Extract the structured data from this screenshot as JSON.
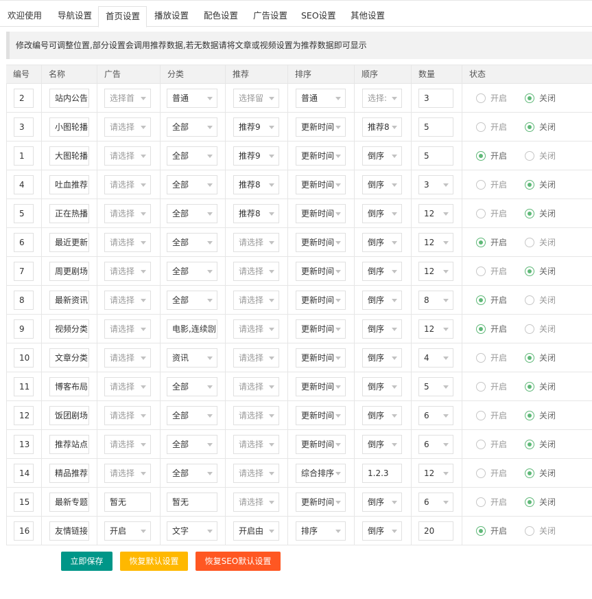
{
  "tabs": [
    "欢迎使用",
    "导航设置",
    "首页设置",
    "播放设置",
    "配色设置",
    "广告设置",
    "SEO设置",
    "其他设置"
  ],
  "active_tab": 2,
  "notice": "修改编号可调整位置,部分设置会调用推荐数据,若无数据请将文章或视频设置为推荐数据即可显示",
  "columns": [
    "编号",
    "名称",
    "广告",
    "分类",
    "推荐",
    "排序",
    "顺序",
    "数量",
    "状态"
  ],
  "radio_labels": {
    "on": "开启",
    "off": "关闭"
  },
  "rows": [
    {
      "no": "2",
      "name": "站内公告",
      "ad": "选择首",
      "cat": "普通",
      "rec": "选择留",
      "sort": "普通",
      "order": "选择:",
      "qty": "3",
      "qty_select": false,
      "status": "off"
    },
    {
      "no": "3",
      "name": "小图轮播",
      "ad": "请选择",
      "cat": "全部",
      "rec": "推荐9",
      "sort": "更新时间",
      "order": "推荐8",
      "qty": "5",
      "qty_select": false,
      "status": "off"
    },
    {
      "no": "1",
      "name": "大图轮播",
      "ad": "请选择",
      "cat": "全部",
      "rec": "推荐9",
      "sort": "更新时间",
      "order": "倒序",
      "qty": "5",
      "qty_select": false,
      "status": "on"
    },
    {
      "no": "4",
      "name": "吐血推荐",
      "ad": "请选择",
      "cat": "全部",
      "rec": "推荐8",
      "sort": "更新时间",
      "order": "倒序",
      "qty": "3",
      "qty_select": true,
      "status": "off"
    },
    {
      "no": "5",
      "name": "正在热播",
      "ad": "请选择",
      "cat": "全部",
      "rec": "推荐8",
      "sort": "更新时间",
      "order": "倒序",
      "qty": "12",
      "qty_select": true,
      "status": "off"
    },
    {
      "no": "6",
      "name": "最近更新",
      "ad": "请选择",
      "cat": "全部",
      "rec": "请选择",
      "sort": "更新时间",
      "order": "倒序",
      "qty": "12",
      "qty_select": true,
      "status": "on"
    },
    {
      "no": "7",
      "name": "周更剧场",
      "ad": "请选择",
      "cat": "全部",
      "rec": "请选择",
      "sort": "更新时间",
      "order": "倒序",
      "qty": "12",
      "qty_select": true,
      "status": "off"
    },
    {
      "no": "8",
      "name": "最新资讯",
      "ad": "请选择",
      "cat": "全部",
      "rec": "请选择",
      "sort": "更新时间",
      "order": "倒序",
      "qty": "8",
      "qty_select": true,
      "status": "on"
    },
    {
      "no": "9",
      "name": "视频分类",
      "ad": "请选择",
      "cat": "电影,连续剧",
      "rec": "请选择",
      "sort": "更新时间",
      "order": "倒序",
      "qty": "12",
      "qty_select": true,
      "status": "on"
    },
    {
      "no": "10",
      "name": "文章分类",
      "ad": "请选择",
      "cat": "资讯",
      "rec": "请选择",
      "sort": "更新时间",
      "order": "倒序",
      "qty": "4",
      "qty_select": true,
      "status": "off"
    },
    {
      "no": "11",
      "name": "博客布局",
      "ad": "请选择",
      "cat": "全部",
      "rec": "请选择",
      "sort": "更新时间",
      "order": "倒序",
      "qty": "5",
      "qty_select": true,
      "status": "off"
    },
    {
      "no": "12",
      "name": "饭团剧场",
      "ad": "请选择",
      "cat": "全部",
      "rec": "请选择",
      "sort": "更新时间",
      "order": "倒序",
      "qty": "6",
      "qty_select": true,
      "status": "off"
    },
    {
      "no": "13",
      "name": "推荐站点",
      "ad": "请选择",
      "cat": "全部",
      "rec": "请选择",
      "sort": "更新时间",
      "order": "倒序",
      "qty": "6",
      "qty_select": true,
      "status": "off"
    },
    {
      "no": "14",
      "name": "精品推荐",
      "ad": "请选择",
      "cat": "全部",
      "rec": "请选择",
      "sort": "综合排序",
      "order": "1.2.3",
      "order_text": true,
      "qty": "12",
      "qty_select": true,
      "status": "off"
    },
    {
      "no": "15",
      "name": "最新专题",
      "ad": "暂无",
      "ad_text": true,
      "cat": "暂无",
      "cat_text": true,
      "rec": "请选择",
      "sort": "更新时间",
      "order": "倒序",
      "qty": "6",
      "qty_select": true,
      "status": "off"
    },
    {
      "no": "16",
      "name": "友情链接",
      "ad": "开启",
      "cat": "文字",
      "rec": "开启由",
      "sort": "排序",
      "order": "倒序",
      "qty": "20",
      "qty_select": false,
      "status": "on"
    }
  ],
  "buttons": {
    "save": "立即保存",
    "restore": "恢复默认设置",
    "restore_seo": "恢复SEO默认设置"
  },
  "colors": {
    "save": "#009688",
    "restore": "#ffb800",
    "restore_seo": "#ff5722",
    "radio_on": "#5fb878"
  }
}
